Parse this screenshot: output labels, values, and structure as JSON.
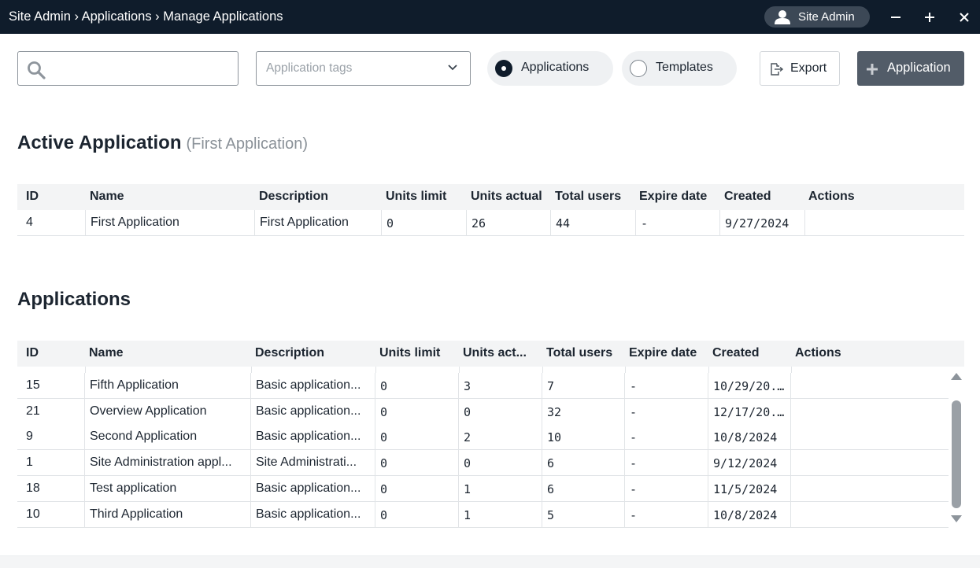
{
  "titlebar": {
    "breadcrumb": "Site Admin › Applications › Manage Applications",
    "user": "Site Admin",
    "icons": [
      "user-icon",
      "minimize-icon",
      "maximize-icon",
      "close-icon"
    ]
  },
  "toolbar": {
    "search_value": "",
    "tags_placeholder": "Application tags",
    "radio_applications": "Applications",
    "radio_templates": "Templates",
    "selected_radio": "Applications",
    "export_label": "Export",
    "add_label": "Application"
  },
  "active": {
    "title": "Active Application",
    "subtitle": "(First Application)",
    "headers": [
      "ID",
      "Name",
      "Description",
      "Units limit",
      "Units actual",
      "Total users",
      "Expire date",
      "Created",
      "Actions"
    ],
    "rows": [
      [
        "4",
        "First Application",
        "First Application",
        "0",
        "26",
        "44",
        "-",
        "9/27/2024",
        ""
      ]
    ]
  },
  "applications": {
    "title": "Applications",
    "headers": [
      "ID",
      "Name",
      "Description",
      "Units limit",
      "Units act...",
      "Total users",
      "Expire date",
      "Created",
      "Actions"
    ],
    "rows": [
      [
        "15",
        "Fifth Application",
        "Basic application...",
        "0",
        "3",
        "7",
        "-",
        "10/29/20...",
        ""
      ],
      [
        "21",
        "Overview Application",
        "Basic application...",
        "0",
        "0",
        "32",
        "-",
        "12/17/20...",
        ""
      ],
      [
        "9",
        "Second Application",
        "Basic application...",
        "0",
        "2",
        "10",
        "-",
        "10/8/2024",
        ""
      ],
      [
        "1",
        "Site Administration appl...",
        "Site Administrati...",
        "0",
        "0",
        "6",
        "-",
        "9/12/2024",
        ""
      ],
      [
        "18",
        "Test application",
        "Basic application...",
        "0",
        "1",
        "6",
        "-",
        "11/5/2024",
        ""
      ],
      [
        "10",
        "Third Application",
        "Basic application...",
        "0",
        "1",
        "5",
        "-",
        "10/8/2024",
        ""
      ]
    ]
  },
  "colors": {
    "titlebar": "#0f1c2b",
    "primary_button": "#525c68",
    "header_row": "#f3f4f5"
  }
}
